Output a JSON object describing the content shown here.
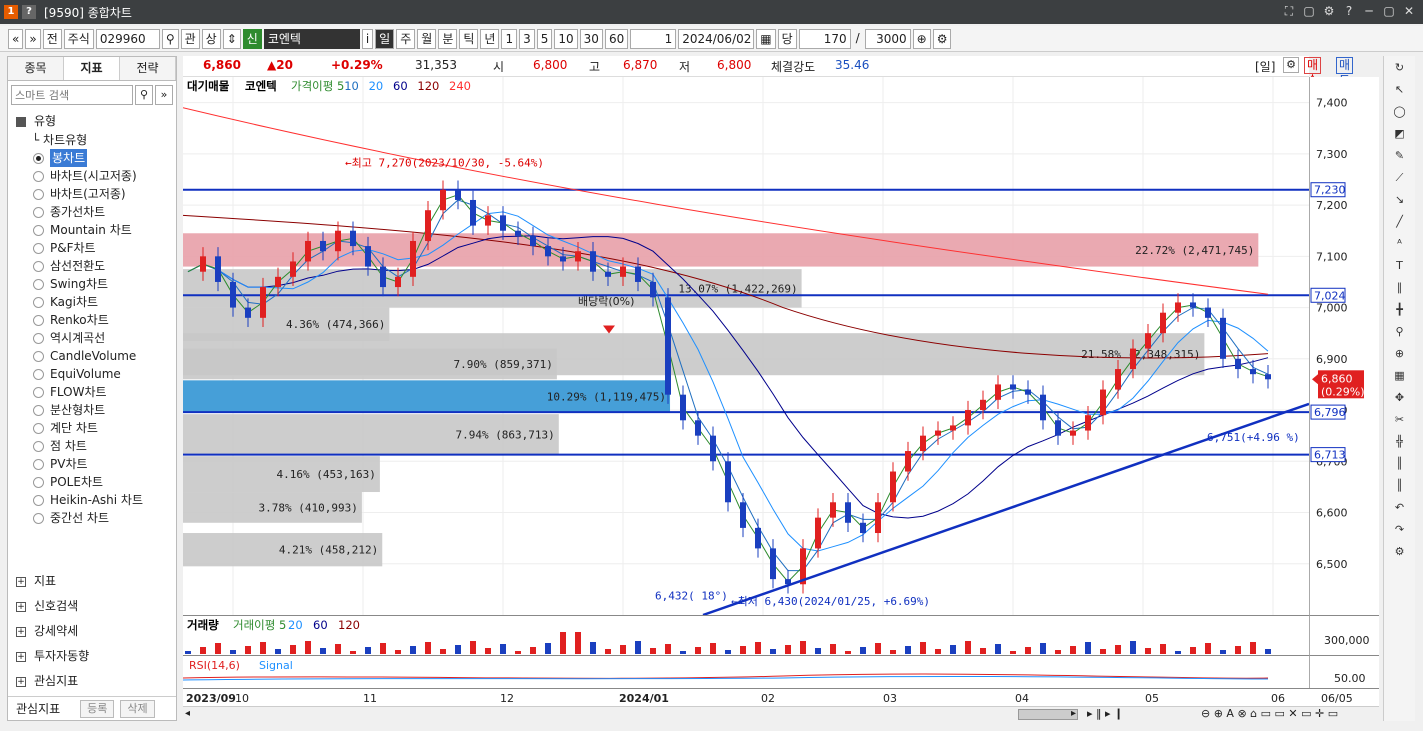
{
  "window": {
    "title": "[9590] 종합차트",
    "controls": [
      "⛶",
      "▢",
      "⚙",
      "?",
      "─",
      "▢",
      "✕"
    ]
  },
  "toolbar": {
    "market": "주식",
    "code": "029960",
    "shin_badge": "신",
    "name": "코엔텍",
    "info_btn": "i",
    "periods": [
      "일",
      "주",
      "월",
      "분",
      "틱",
      "년"
    ],
    "active_period": "일",
    "intervals": [
      "1",
      "3",
      "5",
      "10",
      "30",
      "60"
    ],
    "count_select": "1",
    "date": "2024/06/02",
    "bar_label": "당",
    "bars": "170",
    "total": "3000",
    "nav_left": "«",
    "nav_down": "»",
    "jeon": "전",
    "gwan": "관",
    "sang": "상"
  },
  "left_panel": {
    "tabs": [
      "종목",
      "지표",
      "전략"
    ],
    "active_tab": "지표",
    "search_placeholder": "스마트 검색",
    "section_type": "유형",
    "chart_type_header": "차트유형",
    "chart_types": [
      "봉차트",
      "바차트(시고저종)",
      "바차트(고저종)",
      "종가선차트",
      "Mountain 차트",
      "P&F차트",
      "삼선전환도",
      "Swing차트",
      "Kagi차트",
      "Renko차트",
      "역시계곡선",
      "CandleVolume",
      "EquiVolume",
      "FLOW차트",
      "분산형차트",
      "계단 차트",
      "점 차트",
      "PV차트",
      "POLE차트",
      "Heikin-Ashi 차트",
      "중간선 차트"
    ],
    "selected_type": "봉차트",
    "sections": [
      "지표",
      "신호검색",
      "강세약세",
      "투자자동향",
      "관심지표"
    ],
    "bottom_label": "관심지표",
    "bottom_buttons": [
      "등록",
      "삭제"
    ]
  },
  "info_bar": {
    "price": "6,860",
    "change": "▲20",
    "change_pct": "+0.29%",
    "volume": "31,353",
    "open_label": "시",
    "open": "6,800",
    "high_label": "고",
    "high": "6,870",
    "low_label": "저",
    "low": "6,800",
    "strength_label": "체결강도",
    "strength": "35.46",
    "period_tag": "[일]",
    "buy_btn": "매수",
    "sell_btn": "매도"
  },
  "legend": {
    "items": [
      "대기매물",
      "코엔텍",
      "가격이평 5",
      "10",
      "20",
      "60",
      "120",
      "240"
    ],
    "colors": [
      "#000000",
      "#000000",
      "#2e8b2e",
      "#1f6fc0",
      "#1e90ff",
      "#00008b",
      "#8b0000",
      "#ff3030"
    ]
  },
  "volume_legend": {
    "items": [
      "거래량",
      "거래이평 5",
      "20",
      "60",
      "120"
    ]
  },
  "rsi_legend": {
    "items": [
      "RSI(14,6)",
      "Signal"
    ]
  },
  "annotations": {
    "high": "←최고 7,270(2023/10/30, -5.64%)",
    "low": "←최저 6,430(2024/01/25, +6.69%)",
    "dividend": "배당락(0%)",
    "angle": "6,432( 18°)",
    "trend": "6,751(+4.96 %)"
  },
  "supply_bands": [
    {
      "label": "21.58% (2,348,315)",
      "pct": 21.58,
      "top": 6950,
      "bottom": 6868,
      "color": "#c8c8c8"
    },
    {
      "label": "22.72% (2,471,745)",
      "pct": 22.72,
      "top": 7145,
      "bottom": 7080,
      "color": "#e8a0a8"
    },
    {
      "label": "13.07% (1,422,269)",
      "pct": 13.07,
      "top": 7075,
      "bottom": 7000,
      "color": "#c8c8c8"
    },
    {
      "label": "4.36% (474,366)",
      "pct": 4.36,
      "top": 7000,
      "bottom": 6935,
      "color": "#c8c8c8"
    },
    {
      "label": "7.90% (859,371)",
      "pct": 7.9,
      "top": 6920,
      "bottom": 6860,
      "color": "#c8c8c8"
    },
    {
      "label": "10.29% (1,119,475)",
      "pct": 10.29,
      "top": 6858,
      "bottom": 6795,
      "color": "#3c9ad6"
    },
    {
      "label": "7.94% (863,713)",
      "pct": 7.94,
      "top": 6792,
      "bottom": 6712,
      "color": "#c8c8c8"
    },
    {
      "label": "4.16% (453,163)",
      "pct": 4.16,
      "top": 6710,
      "bottom": 6640,
      "color": "#c8c8c8"
    },
    {
      "label": "3.78% (410,993)",
      "pct": 3.78,
      "top": 6640,
      "bottom": 6580,
      "color": "#c8c8c8"
    },
    {
      "label": "4.21% (458,212)",
      "pct": 4.21,
      "top": 6560,
      "bottom": 6495,
      "color": "#c8c8c8"
    }
  ],
  "hlines": [
    {
      "value": 7230,
      "label": "7,230"
    },
    {
      "value": 7024,
      "label": "7,024"
    },
    {
      "value": 6796,
      "label": "6,796"
    },
    {
      "value": 6713,
      "label": "6,713"
    }
  ],
  "price_axis": {
    "ticks": [
      "7,400",
      "7,300",
      "7,200",
      "7,100",
      "7,000",
      "6,900",
      "6,800",
      "6,700",
      "6,600",
      "6,500"
    ],
    "current": "6,860",
    "current_pct": "(0.29%)"
  },
  "volume_axis": {
    "tick": "300,000"
  },
  "rsi_axis": {
    "tick": "50.00"
  },
  "x_axis": {
    "labels": [
      "2023/09",
      "10",
      "11",
      "12",
      "2024/01",
      "02",
      "03",
      "04",
      "05",
      "06"
    ],
    "end_date": "06/05"
  },
  "chart_data": {
    "type": "candlestick",
    "ylim": [
      6400,
      7450
    ],
    "close_path": [
      7070,
      7100,
      7050,
      7000,
      6980,
      7040,
      7060,
      7090,
      7130,
      7110,
      7150,
      7120,
      7080,
      7040,
      7060,
      7130,
      7190,
      7230,
      7210,
      7160,
      7180,
      7150,
      7140,
      7120,
      7100,
      7090,
      7110,
      7070,
      7060,
      7080,
      7050,
      7020,
      6830,
      6780,
      6750,
      6700,
      6620,
      6570,
      6530,
      6470,
      6460,
      6530,
      6590,
      6620,
      6580,
      6560,
      6620,
      6680,
      6720,
      6750,
      6760,
      6770,
      6800,
      6820,
      6850,
      6840,
      6830,
      6780,
      6750,
      6760,
      6790,
      6840,
      6880,
      6920,
      6950,
      6990,
      7010,
      7000,
      6980,
      6900,
      6880,
      6870,
      6860
    ]
  }
}
